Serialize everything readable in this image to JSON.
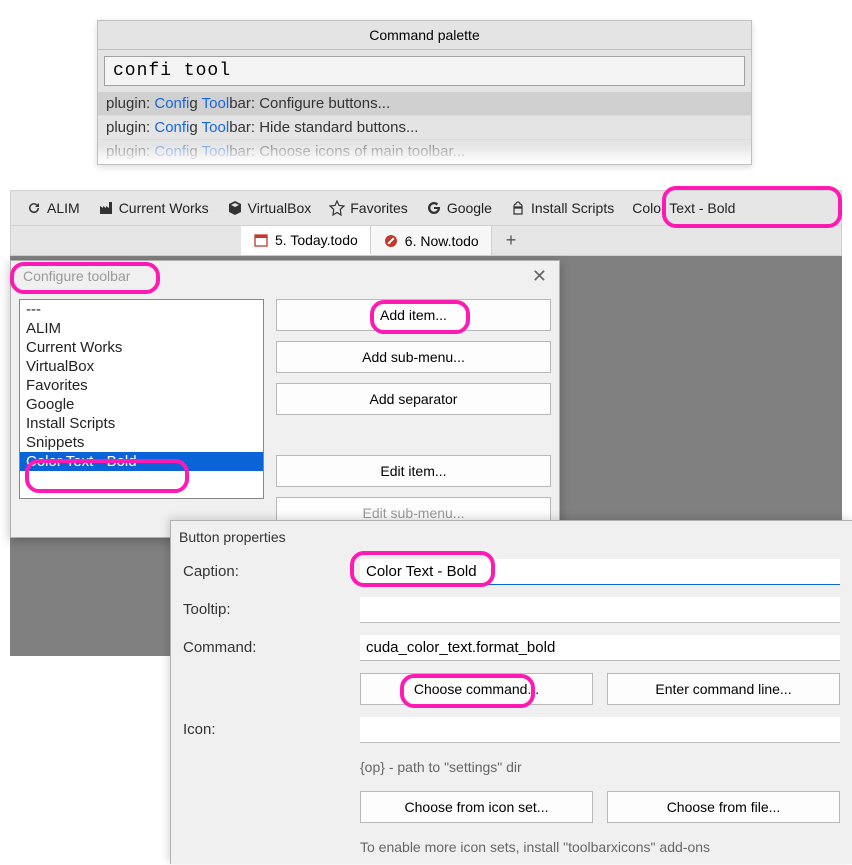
{
  "palette": {
    "title": "Command palette",
    "query": "confi tool",
    "items": [
      {
        "pre": "plugin: ",
        "match1": "Confi",
        "mid1": "g ",
        "match2": "Tool",
        "post": "bar: Configure buttons..."
      },
      {
        "pre": "plugin: ",
        "match1": "Confi",
        "mid1": "g ",
        "match2": "Tool",
        "post": "bar: Hide standard buttons..."
      },
      {
        "pre": "plugin: ",
        "match1": "Confi",
        "mid1": "g ",
        "match2": "Tool",
        "post": "bar: Choose icons of main toolbar..."
      }
    ]
  },
  "toolbar": {
    "items": [
      {
        "icon": "refresh",
        "label": "ALIM"
      },
      {
        "icon": "factory",
        "label": "Current Works"
      },
      {
        "icon": "cube",
        "label": "VirtualBox"
      },
      {
        "icon": "star",
        "label": "Favorites"
      },
      {
        "icon": "google",
        "label": "Google"
      },
      {
        "icon": "chef",
        "label": "Install Scripts"
      },
      {
        "icon": "none",
        "label": "Color Text - Bold"
      }
    ]
  },
  "tabs": {
    "items": [
      {
        "icon": "calendar",
        "label": "5. Today.todo",
        "active": true
      },
      {
        "icon": "nocircle",
        "label": "6. Now.todo",
        "active": false
      }
    ],
    "plus": "+"
  },
  "config": {
    "title": "Configure toolbar",
    "close": "✕",
    "list": [
      "---",
      "ALIM",
      "Current Works",
      "VirtualBox",
      "Favorites",
      "Google",
      "Install Scripts",
      "Snippets",
      "Color Text - Bold"
    ],
    "selected_index": 8,
    "buttons": {
      "add_item": "Add item...",
      "add_submenu": "Add sub-menu...",
      "add_sep": "Add separator",
      "edit_item": "Edit item...",
      "edit_submenu": "Edit sub-menu..."
    }
  },
  "props": {
    "title": "Button properties",
    "caption_label": "Caption:",
    "caption_value": "Color Text - Bold",
    "tooltip_label": "Tooltip:",
    "tooltip_value": "",
    "command_label": "Command:",
    "command_value": "cuda_color_text.format_bold",
    "choose_cmd": "Choose command...",
    "enter_cmd": "Enter command line...",
    "icon_label": "Icon:",
    "icon_hint": "{op} - path to \"settings\" dir",
    "choose_iconset": "Choose from icon set...",
    "choose_file": "Choose from file...",
    "iconset_hint": "To enable more icon sets, install \"toolbarxicons\" add-ons"
  }
}
